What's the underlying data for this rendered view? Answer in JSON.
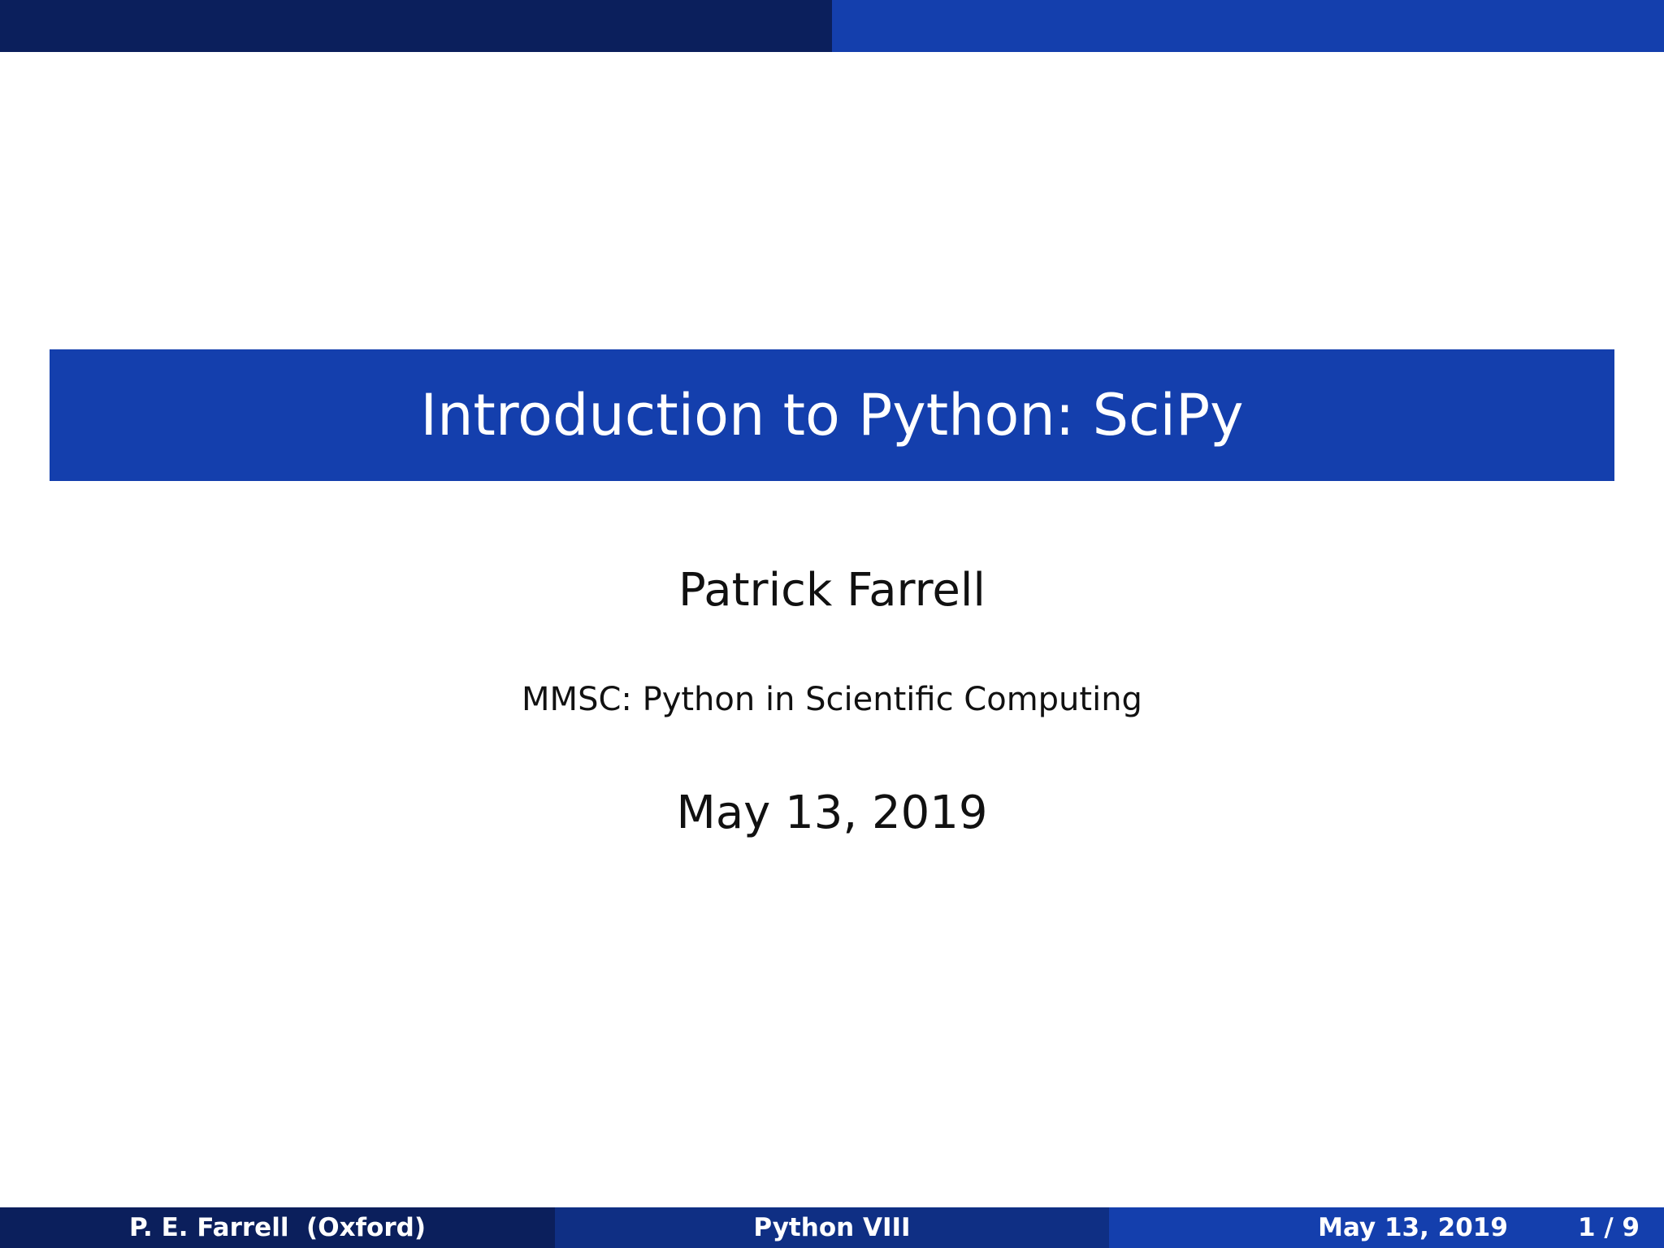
{
  "slide": {
    "title": "Introduction to Python: SciPy",
    "author": "Patrick Farrell",
    "institute": "MMSC: Python in Scientific Computing",
    "date": "May 13, 2019"
  },
  "footer": {
    "author_affil": "P. E. Farrell  (Oxford)",
    "short_title": "Python VIII",
    "date": "May 13, 2019",
    "page": "1 / 9"
  },
  "colors": {
    "dark_navy": "#0b1f5c",
    "mid_navy": "#0f2f84",
    "royal_blue": "#143fad"
  }
}
